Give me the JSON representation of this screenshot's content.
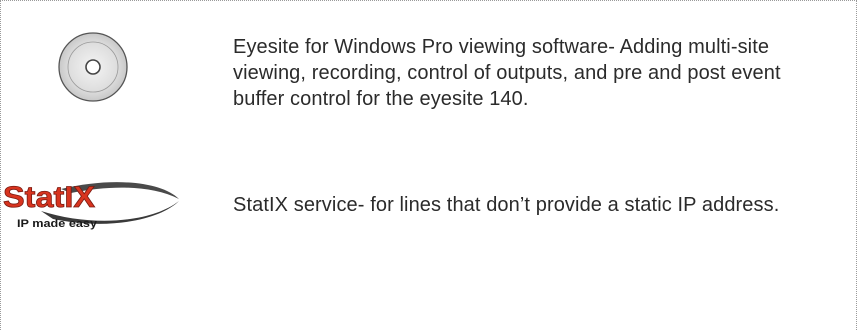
{
  "products": [
    {
      "icon": "cd-disc-icon",
      "description": "Eyesite for Windows Pro viewing software- Adding multi-site viewing, recording, control of outputs, and pre and post event buffer control for the eyesite 140."
    },
    {
      "icon": "statix-logo",
      "logo_word": "StatIX",
      "logo_tagline": "IP made easy",
      "description": "StatIX service- for lines that don’t provide a static IP address."
    }
  ],
  "colors": {
    "text": "#2b2b2b",
    "border": "#9a9a9a",
    "logo_red": "#d8341f",
    "logo_swoosh": "#3a3a3a"
  }
}
